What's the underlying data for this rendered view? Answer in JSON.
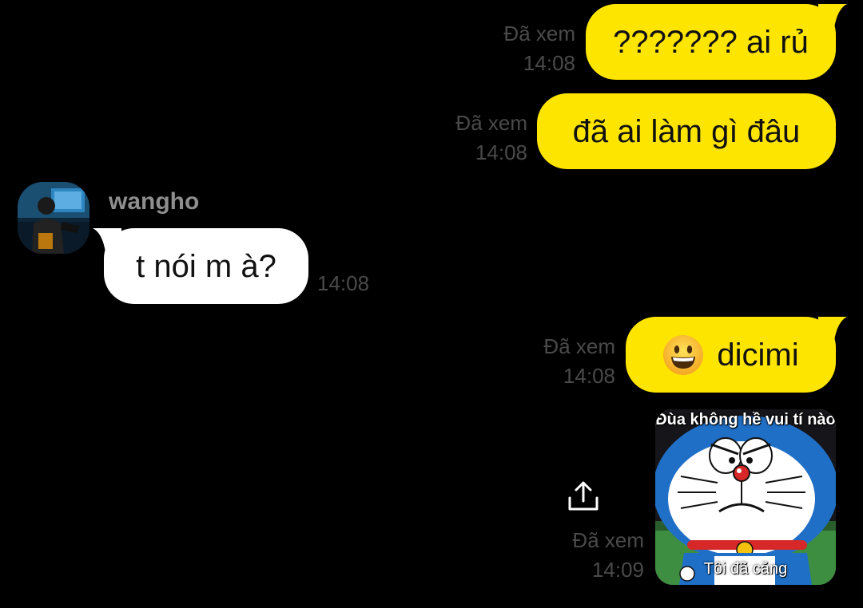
{
  "conversation": {
    "messages": [
      {
        "side": "mine",
        "text": "??????? ai rủ",
        "read_label": "Đã xem",
        "time": "14:08"
      },
      {
        "side": "mine",
        "text": "đã ai làm gì đâu",
        "read_label": "Đã xem",
        "time": "14:08"
      },
      {
        "side": "theirs",
        "sender": "wangho",
        "text": "t nói m à?",
        "time": "14:08"
      },
      {
        "side": "mine",
        "emoji": "grinning-face",
        "text": "dicimi",
        "read_label": "Đã xem",
        "time": "14:08"
      },
      {
        "side": "mine",
        "type": "image",
        "image": {
          "caption_top": "Đùa không hề vui tí nào",
          "caption_bottom": "Tôi đã căng",
          "subject": "doraemon-frowning"
        },
        "read_label": "Đã xem",
        "time": "14:09",
        "action_icon": "share-icon"
      }
    ]
  },
  "colors": {
    "background": "#000000",
    "my_bubble": "#FEE500",
    "their_bubble": "#FFFFFF",
    "meta_text": "#4a4a4a",
    "sender_name": "#8e8e8e"
  }
}
